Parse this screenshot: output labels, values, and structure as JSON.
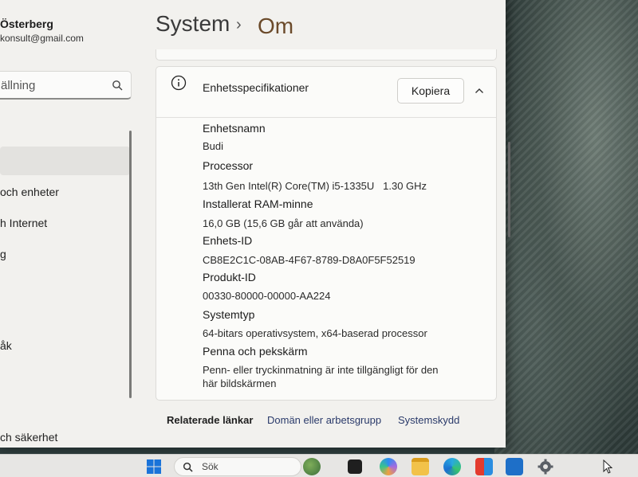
{
  "sidebar": {
    "user_name": "Österberg",
    "user_email": "konsult@gmail.com",
    "search_placeholder": "ällning",
    "items": [
      {
        "label": "och enheter"
      },
      {
        "label": "h Internet"
      },
      {
        "label": "g"
      },
      {
        "label": "åk"
      },
      {
        "label": "ch säkerhet"
      }
    ]
  },
  "header": {
    "title": "System",
    "separator": "›",
    "current": "Om"
  },
  "device_specs": {
    "title": "Enhetsspecifikationer",
    "copy_label": "Kopiera",
    "rows": [
      {
        "label": "Enhetsnamn",
        "value": "Budi"
      },
      {
        "label": "Processor",
        "value": "13th Gen Intel(R) Core(TM) i5-1335U   1.30 GHz"
      },
      {
        "label": "Installerat RAM-minne",
        "value": "16,0 GB (15,6 GB går att använda)"
      },
      {
        "label": "Enhets-ID",
        "value": "CB8E2C1C-08AB-4F67-8789-D8A0F5F52519"
      },
      {
        "label": "Produkt-ID",
        "value": "00330-80000-00000-AA224"
      },
      {
        "label": "Systemtyp",
        "value": "64-bitars operativsystem, x64-baserad processor"
      },
      {
        "label": "Penna och pekskärm",
        "value": "Penn- eller tryckinmatning är inte tillgängligt för den",
        "value2": "här bildskärmen"
      }
    ]
  },
  "related": {
    "title": "Relaterade länkar",
    "links": [
      "Domän eller arbetsgrupp",
      "Systemskydd"
    ]
  },
  "taskbar": {
    "search_label": "Sök"
  },
  "colors": {
    "accent_title": "#6b4a2a",
    "window_bg": "#f2f1ee",
    "taskbar_bg": "#e7e6e4"
  }
}
